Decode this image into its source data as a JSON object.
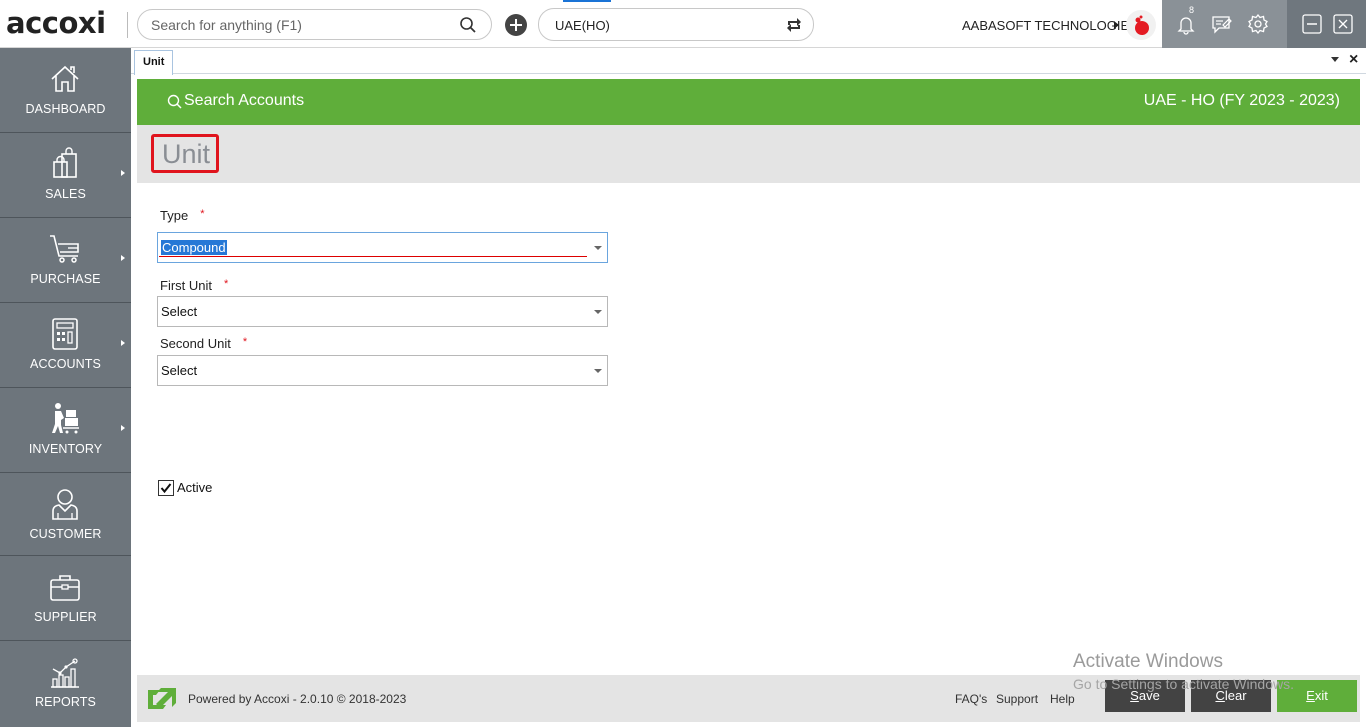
{
  "app": {
    "logo_text": "accoxi",
    "search_placeholder": "Search for anything (F1)",
    "branch": "UAE(HO)",
    "company": "AABASOFT TECHNOLOGIES",
    "notification_count": "8",
    "accent_color": "#5fae3a",
    "sidebar_color": "#6d757c"
  },
  "sidebar": {
    "items": [
      {
        "label": "DASHBOARD",
        "icon": "home-icon",
        "has_submenu": false
      },
      {
        "label": "SALES",
        "icon": "shopping-bag-icon",
        "has_submenu": true
      },
      {
        "label": "PURCHASE",
        "icon": "cart-icon",
        "has_submenu": true
      },
      {
        "label": "ACCOUNTS",
        "icon": "calculator-icon",
        "has_submenu": true
      },
      {
        "label": "INVENTORY",
        "icon": "inventory-worker-icon",
        "has_submenu": true
      },
      {
        "label": "CUSTOMER",
        "icon": "user-icon",
        "has_submenu": false
      },
      {
        "label": "SUPPLIER",
        "icon": "briefcase-icon",
        "has_submenu": false
      },
      {
        "label": "REPORTS",
        "icon": "chart-icon",
        "has_submenu": false
      }
    ]
  },
  "tabs": [
    {
      "label": "Unit",
      "active": true
    }
  ],
  "header": {
    "search_accounts": "Search Accounts",
    "fiscal_year": "UAE - HO (FY 2023 - 2023)",
    "page_title": "Unit"
  },
  "form": {
    "type": {
      "label": "Type",
      "required": "*",
      "value": "Compound"
    },
    "first_unit": {
      "label": "First Unit",
      "required": "*",
      "value": "Select"
    },
    "second_unit": {
      "label": "Second Unit",
      "required": "*",
      "value": "Select"
    },
    "active": {
      "label": "Active",
      "checked": true
    }
  },
  "footer": {
    "powered_by": "Powered by Accoxi - 2.0.10 © 2018-2023",
    "links": [
      "FAQ's",
      "Support",
      "Help"
    ],
    "buttons": {
      "save": {
        "accel": "S",
        "rest": "ave"
      },
      "clear": {
        "accel": "C",
        "rest": "lear"
      },
      "exit": {
        "accel": "E",
        "rest": "xit"
      }
    }
  },
  "watermark": {
    "line1": "Activate Windows",
    "line2": "Go to Settings to activate Windows."
  }
}
